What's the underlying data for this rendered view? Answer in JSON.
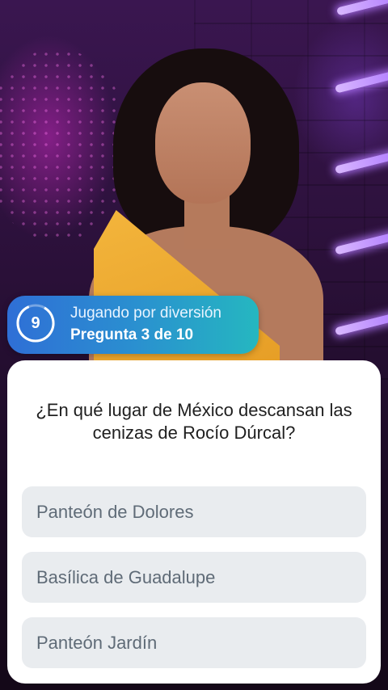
{
  "header": {
    "timer_value": "9",
    "mode_label": "Jugando por diversión",
    "progress_label": "Pregunta 3 de 10"
  },
  "colors": {
    "pill_gradient_start": "#2f6fd6",
    "pill_gradient_end": "#25b7c0",
    "card_background": "#ffffff",
    "option_background": "#e9ecef",
    "option_text": "#5f6b77"
  },
  "question": {
    "text": "¿En qué lugar de México descansan las cenizas de Rocío Dúrcal?"
  },
  "options": [
    {
      "label": "Panteón de Dolores"
    },
    {
      "label": "Basílica de Guadalupe"
    },
    {
      "label": "Panteón Jardín"
    }
  ],
  "icons": {
    "timer": "countdown-ring-icon"
  }
}
